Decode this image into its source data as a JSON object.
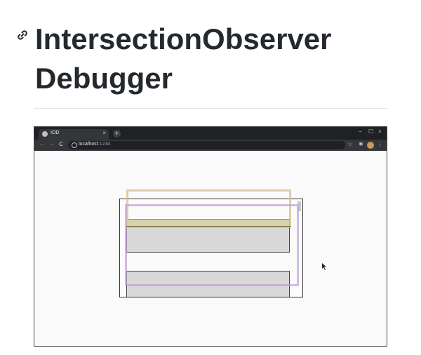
{
  "heading": {
    "title": "IntersectionObserver Debugger",
    "anchor_icon": "link-icon"
  },
  "browser": {
    "tab": {
      "title": "IOD",
      "close": "×",
      "favicon": "globe-icon"
    },
    "new_tab": "+",
    "window_controls": {
      "minimize": "−",
      "maximize": "☐",
      "close": "×"
    },
    "nav": {
      "back": "←",
      "forward": "→",
      "reload": "C"
    },
    "url": {
      "host": "localhost",
      "port": ":1234"
    },
    "toolbar_icons": {
      "bookmark": "☆",
      "extensions": "✱",
      "menu": "⋮"
    },
    "colors": {
      "titlebar": "#202124",
      "toolbar": "#35363a",
      "root_outline": "#d6be8c",
      "target_outline": "#bea0d7",
      "intersection_fill": "#d7cd8c"
    }
  }
}
